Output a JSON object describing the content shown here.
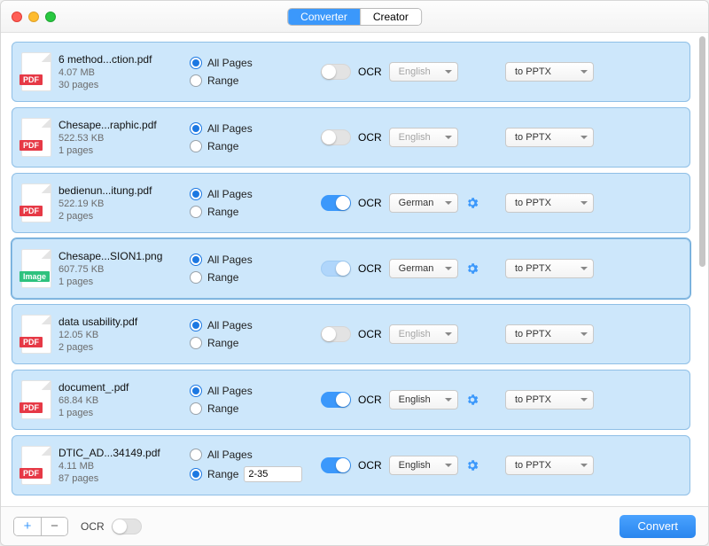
{
  "tabs": {
    "converter": "Converter",
    "creator": "Creator",
    "active": 0
  },
  "labels": {
    "all_pages": "All Pages",
    "range": "Range",
    "ocr": "OCR",
    "to_pptx": "to PPTX",
    "convert": "Convert",
    "footer_ocr": "OCR",
    "plus": "+",
    "minus": "−"
  },
  "rows": [
    {
      "name": "6 method...ction.pdf",
      "size": "4.07 MB",
      "pages": "30 pages",
      "type": "pdf",
      "page_sel": "all",
      "range_val": "",
      "ocr_on": false,
      "ocr_half": false,
      "lang": "English",
      "lang_disabled": true,
      "gear": false,
      "fmt": "to PPTX"
    },
    {
      "name": "Chesape...raphic.pdf",
      "size": "522.53 KB",
      "pages": "1 pages",
      "type": "pdf",
      "page_sel": "all",
      "range_val": "",
      "ocr_on": false,
      "ocr_half": false,
      "lang": "English",
      "lang_disabled": true,
      "gear": false,
      "fmt": "to PPTX"
    },
    {
      "name": "bedienun...itung.pdf",
      "size": "522.19 KB",
      "pages": "2 pages",
      "type": "pdf",
      "page_sel": "all",
      "range_val": "",
      "ocr_on": true,
      "ocr_half": false,
      "lang": "German",
      "lang_disabled": false,
      "gear": true,
      "fmt": "to PPTX"
    },
    {
      "name": "Chesape...SION1.png",
      "size": "607.75 KB",
      "pages": "1 pages",
      "type": "img",
      "page_sel": "all",
      "range_val": "",
      "ocr_on": true,
      "ocr_half": true,
      "lang": "German",
      "lang_disabled": false,
      "gear": true,
      "fmt": "to PPTX"
    },
    {
      "name": "data usability.pdf",
      "size": "12.05 KB",
      "pages": "2 pages",
      "type": "pdf",
      "page_sel": "all",
      "range_val": "",
      "ocr_on": false,
      "ocr_half": false,
      "lang": "English",
      "lang_disabled": true,
      "gear": false,
      "fmt": "to PPTX"
    },
    {
      "name": "document_.pdf",
      "size": "68.84 KB",
      "pages": "1 pages",
      "type": "pdf",
      "page_sel": "all",
      "range_val": "",
      "ocr_on": true,
      "ocr_half": false,
      "lang": "English",
      "lang_disabled": false,
      "gear": true,
      "fmt": "to PPTX"
    },
    {
      "name": "DTIC_AD...34149.pdf",
      "size": "4.11 MB",
      "pages": "87 pages",
      "type": "pdf",
      "page_sel": "range",
      "range_val": "2-35",
      "ocr_on": true,
      "ocr_half": false,
      "lang": "English",
      "lang_disabled": false,
      "gear": true,
      "fmt": "to PPTX"
    }
  ],
  "footer_ocr_on": false,
  "selected_row": 3
}
